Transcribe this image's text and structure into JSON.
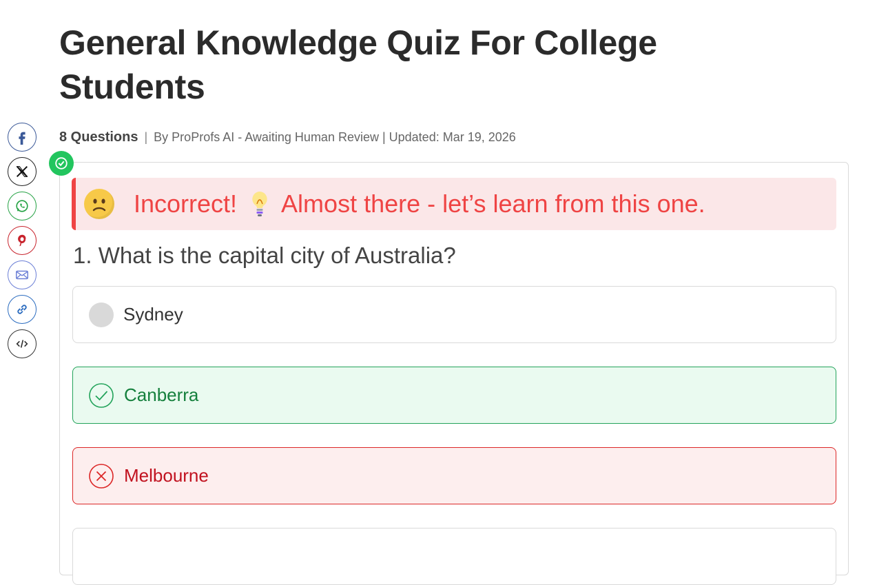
{
  "page": {
    "title": "General Knowledge Quiz For College Students",
    "question_count": "8 Questions",
    "separator": "|",
    "byline": "By ProProfs AI - Awaiting Human Review | Updated: Mar 19, 2026"
  },
  "share": {
    "items": [
      "facebook-icon",
      "x-icon",
      "whatsapp-icon",
      "pinterest-icon",
      "email-icon",
      "link-icon",
      "embed-icon"
    ]
  },
  "feedback": {
    "status": "Incorrect!",
    "message": "Almost there - let’s learn from this one.",
    "face_icon": "slightly-frowning-face-icon",
    "hint_icon": "light-bulb-icon",
    "color": "#ef4444",
    "bg": "#fbe7e8"
  },
  "question": {
    "text": "1. What is the capital city of Australia?",
    "options": [
      {
        "label": "Sydney",
        "state": "neutral"
      },
      {
        "label": "Canberra",
        "state": "correct"
      },
      {
        "label": "Melbourne",
        "state": "incorrect"
      },
      {
        "label": "",
        "state": "neutral"
      }
    ]
  },
  "colors": {
    "correct": "#15803d",
    "incorrect": "#c1121f",
    "badge": "#22c55e"
  }
}
